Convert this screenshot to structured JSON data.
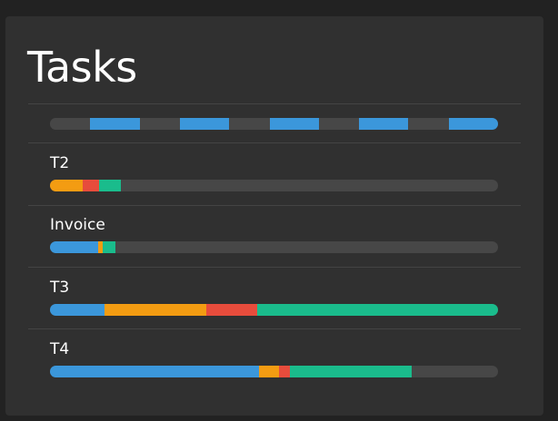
{
  "page": {
    "title": "Tasks"
  },
  "colors": {
    "background": "#222222",
    "panel": "#303030",
    "track": "#474747",
    "blue": "#3b97db",
    "orange": "#f39c12",
    "red": "#e74c3c",
    "green": "#1abc8c"
  },
  "header_bar": {
    "description_note": "dashed blue/dark pattern summary bar",
    "pattern": [
      "blue",
      "dark",
      "blue",
      "dark",
      "blue",
      "dark",
      "blue",
      "dark",
      "blue"
    ],
    "segments": [
      {
        "color": "track",
        "share": 0.09
      },
      {
        "color": "blue",
        "share": 0.11
      },
      {
        "color": "track",
        "share": 0.09
      },
      {
        "color": "blue",
        "share": 0.11
      },
      {
        "color": "track",
        "share": 0.09
      },
      {
        "color": "blue",
        "share": 0.11
      },
      {
        "color": "track",
        "share": 0.09
      },
      {
        "color": "blue",
        "share": 0.11
      },
      {
        "color": "track",
        "share": 0.09
      },
      {
        "color": "blue",
        "share": 0.11
      }
    ]
  },
  "tasks": [
    {
      "name": "T2",
      "segments": [
        {
          "color": "orange",
          "share": 0.073
        },
        {
          "color": "red",
          "share": 0.036
        },
        {
          "color": "green",
          "share": 0.049
        }
      ]
    },
    {
      "name": "Invoice",
      "segments": [
        {
          "color": "blue",
          "share": 0.108
        },
        {
          "color": "orange",
          "share": 0.01
        },
        {
          "color": "green",
          "share": 0.028
        }
      ]
    },
    {
      "name": "T3",
      "segments": [
        {
          "color": "blue",
          "share": 0.122
        },
        {
          "color": "orange",
          "share": 0.227
        },
        {
          "color": "red",
          "share": 0.114
        },
        {
          "color": "green",
          "share": 0.537
        }
      ]
    },
    {
      "name": "T4",
      "segments": [
        {
          "color": "blue",
          "share": 0.467
        },
        {
          "color": "orange",
          "share": 0.045
        },
        {
          "color": "red",
          "share": 0.024
        },
        {
          "color": "green",
          "share": 0.272
        }
      ]
    }
  ]
}
